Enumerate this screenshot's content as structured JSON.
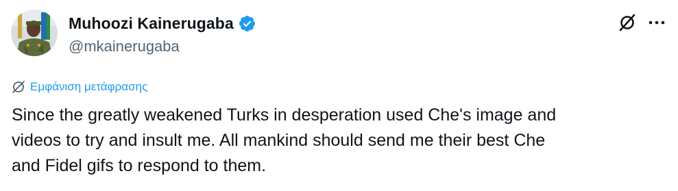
{
  "author": {
    "display_name": "Muhoozi Kainerugaba",
    "handle": "@mkainerugaba",
    "verified": true
  },
  "actions": {
    "grok_icon": "grok-icon",
    "more_icon": "more-horizontal-icon"
  },
  "translate": {
    "label": "Εμφάνιση μετάφρασης",
    "icon": "globe-icon"
  },
  "tweet": {
    "text": "Since the greatly weakened Turks in desperation used Che's image and\nvideos to try and insult me. All mankind should send me their best Che\nand Fidel gifs to respond to them."
  },
  "colors": {
    "accent": "#1d9bf0",
    "text": "#0f1419",
    "secondary": "#536471"
  }
}
